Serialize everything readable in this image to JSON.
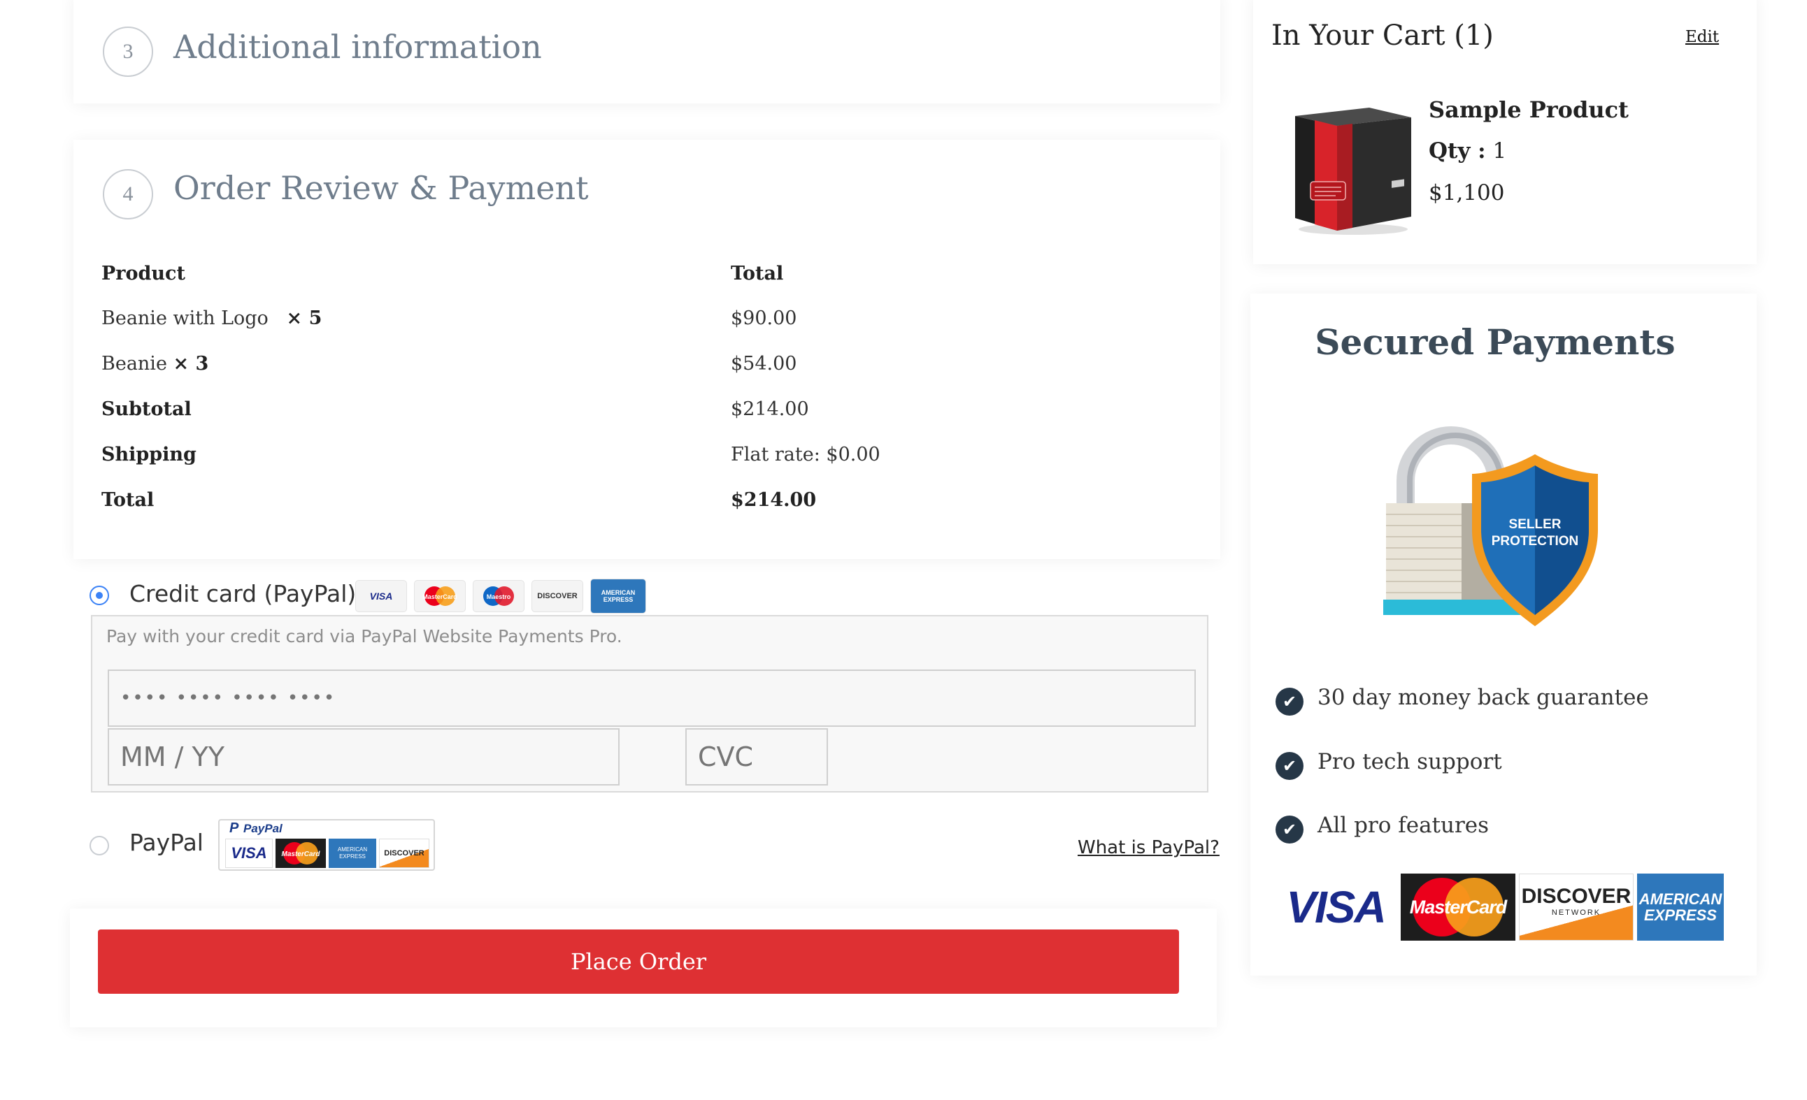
{
  "steps": {
    "additional": {
      "number": "3",
      "title": "Additional information"
    },
    "review": {
      "number": "4",
      "title": "Order Review & Payment"
    }
  },
  "review_table": {
    "headers": {
      "product": "Product",
      "total": "Total"
    },
    "items": [
      {
        "name": "Beanie with Logo",
        "qty": "× 5",
        "total": "$90.00"
      },
      {
        "name": "Beanie",
        "qty": "× 3",
        "total": "$54.00"
      }
    ],
    "subtotal": {
      "label": "Subtotal",
      "value": "$214.00"
    },
    "shipping": {
      "label": "Shipping",
      "value": "Flat rate: $0.00"
    },
    "total": {
      "label": "Total",
      "value": "$214.00"
    }
  },
  "payment": {
    "credit_card": {
      "label": "Credit card (PayPal)",
      "selected": true,
      "description": "Pay with your credit card via PayPal Website Payments Pro.",
      "card_number_placeholder": "•••• •••• •••• ••••",
      "expiry_placeholder": "MM / YY",
      "cvc_placeholder": "CVC",
      "card_logos": [
        "VISA",
        "MasterCard",
        "Maestro",
        "DISCOVER",
        "AMERICAN EXPRESS"
      ]
    },
    "paypal": {
      "label": "PayPal",
      "selected": false,
      "what_is_link": "What is PayPal?",
      "badge_title": "PayPal",
      "badge_logos": [
        "VISA",
        "MasterCard",
        "AMERICAN EXPRESS",
        "DISCOVER"
      ]
    },
    "place_order_label": "Place Order"
  },
  "cart": {
    "title": "In Your Cart (1)",
    "edit_label": "Edit",
    "product_name": "Sample Product",
    "qty_label": "Qty :",
    "qty_value": "1",
    "price": "$1,100"
  },
  "secured": {
    "title": "Secured Payments",
    "shield_text": "SELLER PROTECTION",
    "features": [
      "30 day money back guarantee",
      "Pro tech support",
      "All pro features"
    ],
    "brands": [
      "VISA",
      "MasterCard",
      "DISCOVER",
      "NETWORK",
      "AMERICAN EXPRESS"
    ]
  },
  "colors": {
    "accent_red": "#de3033",
    "radio_blue": "#3b82f6",
    "heading_gray": "#6f7d8c",
    "check_dark": "#263747"
  }
}
